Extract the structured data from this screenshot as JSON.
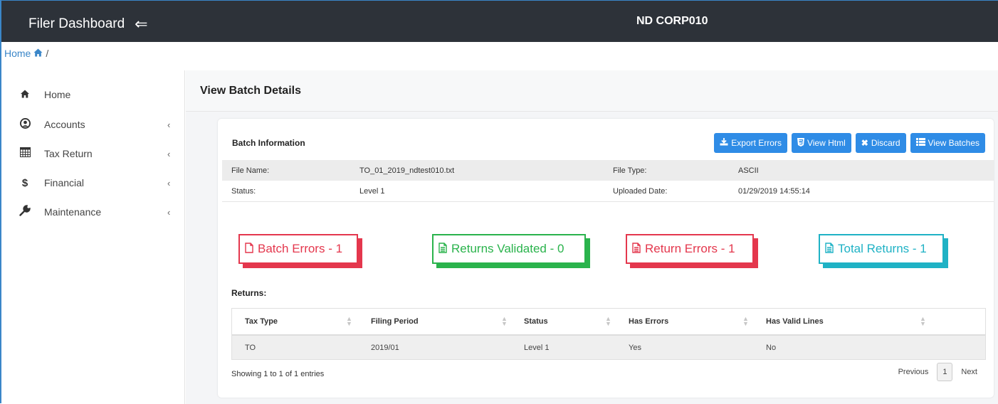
{
  "topbar": {
    "brand": "Filer Dashboard",
    "title": "ND CORP010"
  },
  "breadcrumb": {
    "home": "Home",
    "separator": "/"
  },
  "sidebar": {
    "items": [
      {
        "label": "Home",
        "icon": "home-icon",
        "has_children": false
      },
      {
        "label": "Accounts",
        "icon": "user-circle-icon",
        "has_children": true
      },
      {
        "label": "Tax Return",
        "icon": "calculator-icon",
        "has_children": true
      },
      {
        "label": "Financial",
        "icon": "dollar-icon",
        "has_children": true
      },
      {
        "label": "Maintenance",
        "icon": "wrench-icon",
        "has_children": true
      }
    ]
  },
  "page": {
    "title": "View Batch Details"
  },
  "batch": {
    "section_title": "Batch Information",
    "buttons": {
      "export": "Export Errors",
      "view_html": "View Html",
      "discard": "Discard",
      "view_batches": "View Batches"
    },
    "file_name_label": "File Name:",
    "file_name": "TO_01_2019_ndtest010.txt",
    "file_type_label": "File Type:",
    "file_type": "ASCII",
    "status_label": "Status:",
    "status": "Level 1",
    "uploaded_label": "Uploaded Date:",
    "uploaded": "01/29/2019 14:55:14"
  },
  "stats": {
    "batch_errors": "Batch Errors - 1",
    "returns_validated": "Returns Validated - 0",
    "return_errors": "Return Errors - 1",
    "total_returns": "Total Returns - 1"
  },
  "returns": {
    "label": "Returns:",
    "columns": [
      "Tax Type",
      "Filing Period",
      "Status",
      "Has Errors",
      "Has Valid Lines"
    ],
    "rows": [
      [
        "TO",
        "2019/01",
        "Level 1",
        "Yes",
        "No"
      ]
    ],
    "footer": "Showing 1 to 1 of 1 entries",
    "pager": {
      "previous": "Previous",
      "page": "1",
      "next": "Next"
    }
  },
  "colors": {
    "topbar": "#2d3239",
    "primary": "#2f8ce6",
    "danger": "#e4374d",
    "success": "#2ab34c",
    "info": "#1fb2c5"
  }
}
